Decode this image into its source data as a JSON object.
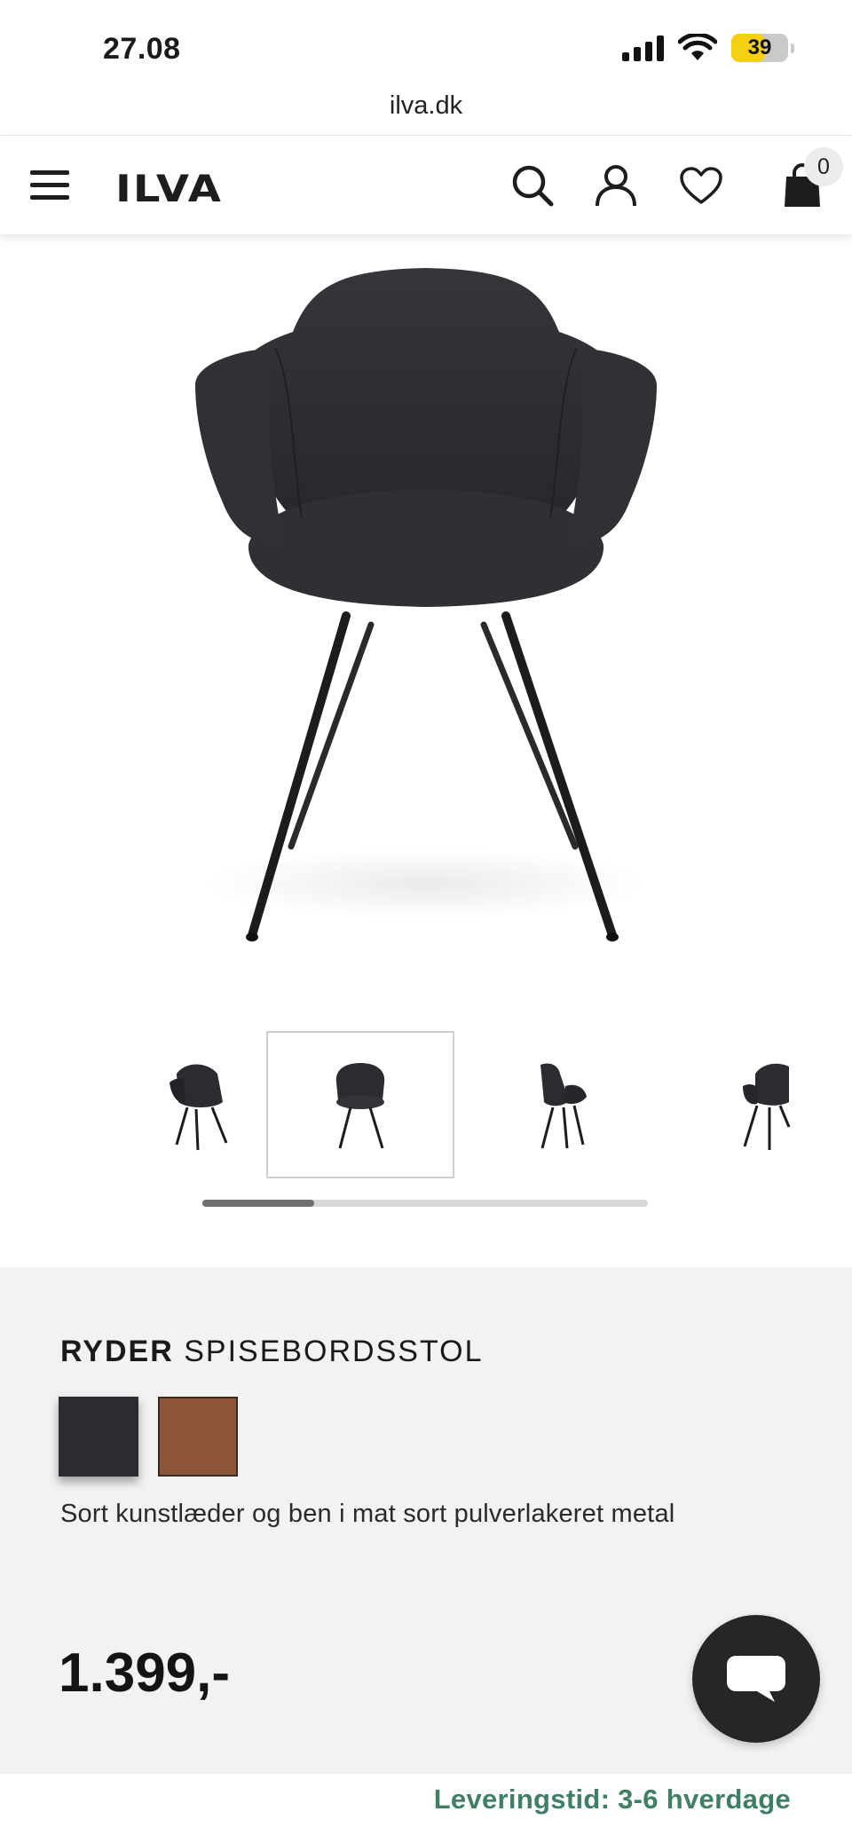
{
  "status_bar": {
    "time": "27.08",
    "battery_level": "39",
    "url": "ilva.dk"
  },
  "header": {
    "logo": "ILVA",
    "cart_count": "0",
    "icons": [
      "menu-icon",
      "search-icon",
      "user-icon",
      "heart-icon",
      "shopping-bag-icon"
    ]
  },
  "gallery": {
    "thumbnail_count": 4,
    "active_thumbnail": 2,
    "scroll_progress": 0.25
  },
  "product": {
    "brand": "RYDER",
    "name": "SPISEBORDSSTOL",
    "swatches": [
      {
        "color": "#2b2c30",
        "selected": true
      },
      {
        "color": "#8d563a",
        "selected": false
      }
    ],
    "description": "Sort kunstlæder og ben i mat sort pulverlakeret metal",
    "price": "1.399,-",
    "delivery": "Leveringstid: 3-6 hverdage"
  },
  "colors": {
    "accent_green": "#3f7f64",
    "panel_bg": "#f3f2f0",
    "chat_bg": "#262626"
  }
}
